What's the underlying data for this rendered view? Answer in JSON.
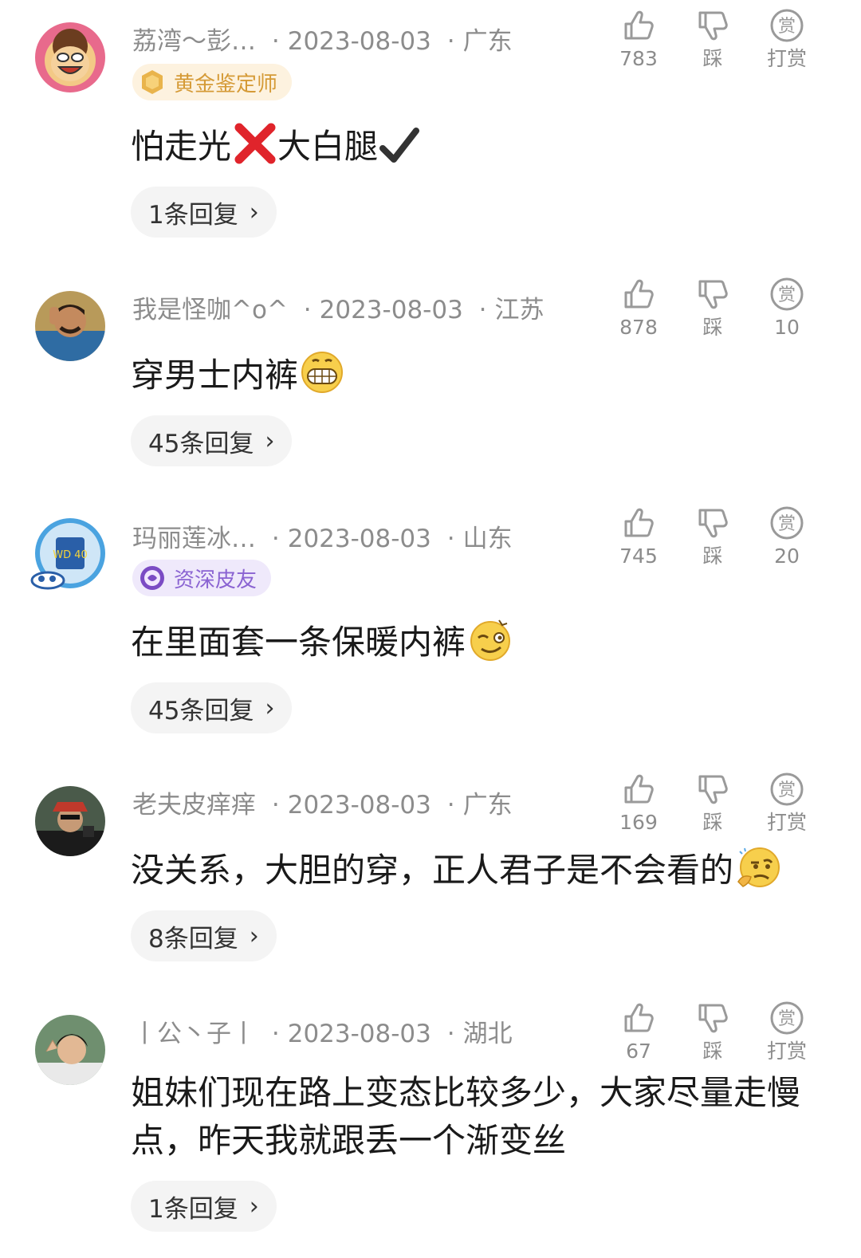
{
  "comments": [
    {
      "username": "荔湾～彭…",
      "date": "2023-08-03",
      "location": "广东",
      "badge": "黄金鉴定师",
      "content": "怕走光",
      "content_tail": "大白腿",
      "replies": "1条回复",
      "likes": "783",
      "dislike_label": "踩",
      "reward": "打赏"
    },
    {
      "username": "我是怪咖^o^",
      "date": "2023-08-03",
      "location": "江苏",
      "content": "穿男士内裤",
      "replies": "45条回复",
      "likes": "878",
      "dislike_label": "踩",
      "reward": "10"
    },
    {
      "username": "玛丽莲冰…",
      "date": "2023-08-03",
      "location": "山东",
      "badge": "资深皮友",
      "content": "在里面套一条保暖内裤",
      "replies": "45条回复",
      "likes": "745",
      "dislike_label": "踩",
      "reward": "20"
    },
    {
      "username": "老夫皮痒痒",
      "date": "2023-08-03",
      "location": "广东",
      "content": "没关系，大胆的穿，正人君子是不会看的",
      "replies": "8条回复",
      "likes": "169",
      "dislike_label": "踩",
      "reward": "打赏"
    },
    {
      "username": "丨公丶子丨",
      "date": "2023-08-03",
      "location": "湖北",
      "content": "姐妹们现在路上变态比较多少，大家尽量走慢点，昨天我就跟丢一个渐变丝",
      "replies": "1条回复",
      "likes": "67",
      "dislike_label": "踩",
      "reward": "打赏"
    }
  ],
  "icons": {
    "like": "thumbs-up-icon",
    "dislike": "thumbs-down-icon",
    "reward": "reward-icon",
    "chevron": "›"
  },
  "colors": {
    "meta": "#8c8c8c",
    "gold_badge_bg": "#fdf2df",
    "gold_badge_text": "#d59a36",
    "purple_badge_bg": "#efe9fb",
    "purple_badge_text": "#8a63d2"
  }
}
